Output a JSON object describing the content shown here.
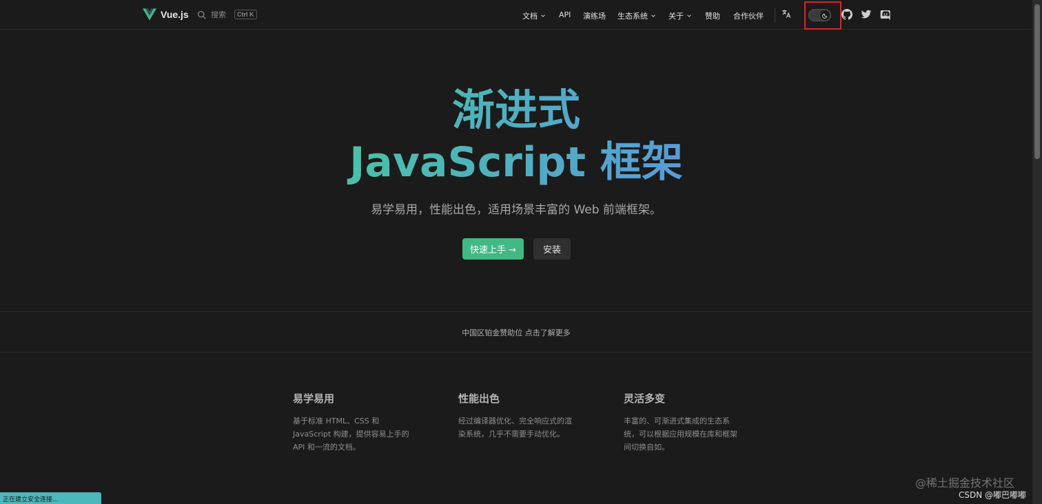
{
  "nav": {
    "brand": "Vue.js",
    "search_label": "搜索",
    "search_shortcut": "Ctrl K",
    "items": [
      {
        "label": "文档",
        "dropdown": true
      },
      {
        "label": "API",
        "dropdown": false
      },
      {
        "label": "演练场",
        "dropdown": false
      },
      {
        "label": "生态系统",
        "dropdown": true
      },
      {
        "label": "关于",
        "dropdown": true
      },
      {
        "label": "赞助",
        "dropdown": false
      },
      {
        "label": "合作伙伴",
        "dropdown": false
      }
    ],
    "icons": [
      "translate-icon",
      "appearance-toggle",
      "github-icon",
      "twitter-icon",
      "discord-icon"
    ],
    "theme": "dark"
  },
  "hero": {
    "title_line1": "渐进式",
    "title_line2": "JavaScript 框架",
    "tagline": "易学易用，性能出色，适用场景丰富的 Web 前端框架。",
    "primary_button": "快速上手 →",
    "secondary_button": "安装"
  },
  "sponsor": {
    "text": "中国区铂金赞助位 点击了解更多"
  },
  "features": [
    {
      "title": "易学易用",
      "desc": "基于标准 HTML、CSS 和 JavaScript 构建，提供容易上手的 API 和一流的文档。"
    },
    {
      "title": "性能出色",
      "desc": "经过编译器优化、完全响应式的渲染系统，几乎不需要手动优化。"
    },
    {
      "title": "灵活多变",
      "desc": "丰富的、可渐进式集成的生态系统，可以根据应用规模在库和框架间切换自如。"
    }
  ],
  "status_bar": "正在建立安全连接...",
  "watermark": {
    "line1": "@稀土掘金技术社区",
    "line2": "CSDN @嘟巴嘟嘟"
  },
  "colors": {
    "background": "#1b1b1b",
    "accent": "#42b883",
    "gradient_start": "#42d392",
    "gradient_end": "#647eff",
    "highlight_box": "#e02424"
  }
}
